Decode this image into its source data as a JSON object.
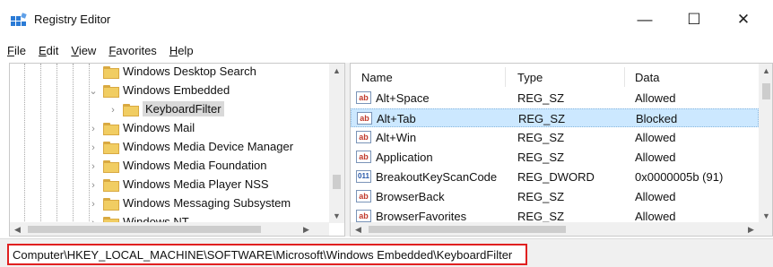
{
  "window": {
    "title": "Registry Editor",
    "icon": "registry-editor-icon",
    "controls": {
      "minimize": "—",
      "maximize": "☐",
      "close": "✕"
    }
  },
  "menu": [
    "File",
    "Edit",
    "View",
    "Favorites",
    "Help"
  ],
  "tree": {
    "items": [
      {
        "label": "Windows Desktop Search",
        "expander": "",
        "selected": false
      },
      {
        "label": "Windows Embedded",
        "expander": "expanded",
        "selected": false
      },
      {
        "label": "KeyboardFilter",
        "expander": "collapsed",
        "selected": true
      },
      {
        "label": "Windows Mail",
        "expander": "collapsed",
        "selected": false
      },
      {
        "label": "Windows Media Device Manager",
        "expander": "collapsed",
        "selected": false
      },
      {
        "label": "Windows Media Foundation",
        "expander": "collapsed",
        "selected": false
      },
      {
        "label": "Windows Media Player NSS",
        "expander": "collapsed",
        "selected": false
      },
      {
        "label": "Windows Messaging Subsystem",
        "expander": "collapsed",
        "selected": false
      },
      {
        "label": "Windows NT",
        "expander": "collapsed",
        "selected": false
      }
    ]
  },
  "list": {
    "columns": [
      "Name",
      "Type",
      "Data"
    ],
    "rows": [
      {
        "icon": "ab",
        "name": "Alt+Space",
        "type": "REG_SZ",
        "data": "Allowed",
        "selected": false
      },
      {
        "icon": "ab",
        "name": "Alt+Tab",
        "type": "REG_SZ",
        "data": "Blocked",
        "selected": true
      },
      {
        "icon": "ab",
        "name": "Alt+Win",
        "type": "REG_SZ",
        "data": "Allowed",
        "selected": false
      },
      {
        "icon": "ab",
        "name": "Application",
        "type": "REG_SZ",
        "data": "Allowed",
        "selected": false
      },
      {
        "icon": "dword",
        "name": "BreakoutKeyScanCode",
        "type": "REG_DWORD",
        "data": "0x0000005b (91)",
        "selected": false
      },
      {
        "icon": "ab",
        "name": "BrowserBack",
        "type": "REG_SZ",
        "data": "Allowed",
        "selected": false
      },
      {
        "icon": "ab",
        "name": "BrowserFavorites",
        "type": "REG_SZ",
        "data": "Allowed",
        "selected": false
      }
    ]
  },
  "status": {
    "path": "Computer\\HKEY_LOCAL_MACHINE\\SOFTWARE\\Microsoft\\Windows Embedded\\KeyboardFilter",
    "highlight_color": "#e02020"
  },
  "colors": {
    "selection": "#cce8ff",
    "tree_selection": "#d9d9d9"
  }
}
